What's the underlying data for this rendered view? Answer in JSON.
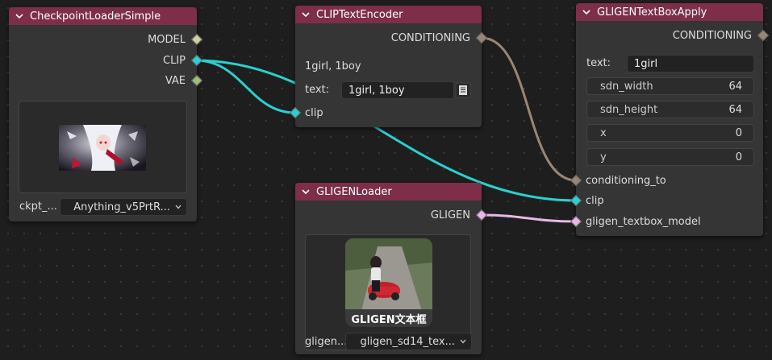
{
  "colors": {
    "clip": "#2ad0cf",
    "conditioning": "#9a8573",
    "gligen": "#e8b7e8",
    "model": "#cfcfa0",
    "vae": "#9cbd7e",
    "header": "#7e2e48"
  },
  "checkpoint": {
    "title": "CheckpointLoaderSimple",
    "outputs": [
      "MODEL",
      "CLIP",
      "VAE"
    ],
    "widget_label": "ckpt_...",
    "widget_value": "Anything_v5PrtR..."
  },
  "clip_encoder": {
    "title": "CLIPTextEncoder",
    "output": "CONDITIONING",
    "text_display": "1girl, 1boy",
    "text_label": "text:",
    "text_value": "1girl, 1boy",
    "input": "clip"
  },
  "gligen_loader": {
    "title": "GLIGENLoader",
    "output": "GLIGEN",
    "preview_caption": "GLIGEN文本框",
    "widget_label": "gligen...",
    "widget_value": "gligen_sd14_tex..."
  },
  "textbox_apply": {
    "title": "GLIGENTextBoxApply",
    "output": "CONDITIONING",
    "text_label": "text:",
    "text_value": "1girl",
    "widgets": [
      {
        "label": "sdn_width",
        "value": "64"
      },
      {
        "label": "sdn_height",
        "value": "64"
      },
      {
        "label": "x",
        "value": "0"
      },
      {
        "label": "y",
        "value": "0"
      }
    ],
    "inputs": [
      "conditioning_to",
      "clip",
      "gligen_textbox_model"
    ]
  }
}
